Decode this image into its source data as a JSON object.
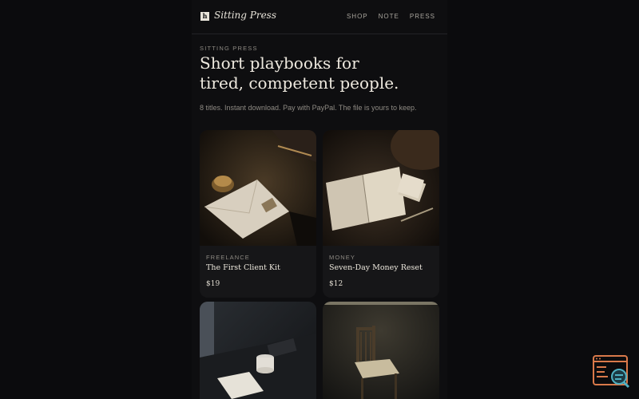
{
  "brand": {
    "name": "Sitting Press",
    "logo_mark": "h"
  },
  "nav": {
    "items": [
      "SHOP",
      "NOTE",
      "PRESS"
    ]
  },
  "hero": {
    "eyebrow": "SITTING PRESS",
    "headline_line1": "Short playbooks for",
    "headline_line2": "tired, competent people.",
    "subtitle": "8 titles. Instant download. Pay with PayPal. The file is yours to keep."
  },
  "products": [
    {
      "category": "FREELANCE",
      "title": "The First Client Kit",
      "price": "$19",
      "image": "envelope-on-desk-photo"
    },
    {
      "category": "MONEY",
      "title": "Seven-Day Money Reset",
      "price": "$12",
      "image": "open-notebook-photo"
    },
    {
      "category": "",
      "title": "",
      "price": "",
      "image": "coffee-cup-table-photo"
    },
    {
      "category": "",
      "title": "",
      "price": "",
      "image": "wooden-chair-photo"
    }
  ],
  "colors": {
    "background": "#0b0b0d",
    "card": "#161618",
    "text": "#efeae0",
    "muted": "#8e8a83",
    "badge": "#d9794a"
  }
}
